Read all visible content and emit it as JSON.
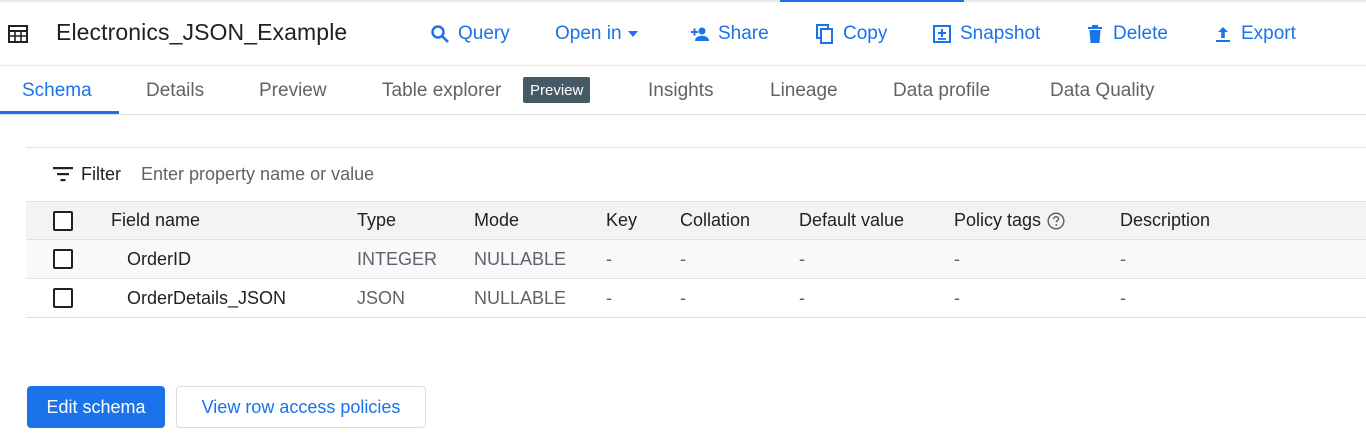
{
  "header": {
    "title": "Electronics_JSON_Example",
    "icon": "table-icon"
  },
  "actions": [
    {
      "label": "Query",
      "icon": "search-icon"
    },
    {
      "label": "Open in",
      "icon": "caret-down-icon"
    },
    {
      "label": "Share",
      "icon": "person-add-icon"
    },
    {
      "label": "Copy",
      "icon": "copy-icon"
    },
    {
      "label": "Snapshot",
      "icon": "snapshot-icon"
    },
    {
      "label": "Delete",
      "icon": "trash-icon"
    },
    {
      "label": "Export",
      "icon": "upload-icon"
    }
  ],
  "tabs": [
    {
      "label": "Schema",
      "active": true
    },
    {
      "label": "Details"
    },
    {
      "label": "Preview"
    },
    {
      "label": "Table explorer",
      "badge": "Preview"
    },
    {
      "label": "Insights"
    },
    {
      "label": "Lineage"
    },
    {
      "label": "Data profile"
    },
    {
      "label": "Data Quality"
    }
  ],
  "filter": {
    "label": "Filter",
    "placeholder": "Enter property name or value",
    "value": ""
  },
  "table": {
    "columns": [
      "Field name",
      "Type",
      "Mode",
      "Key",
      "Collation",
      "Default value",
      "Policy tags",
      "Description"
    ],
    "rows": [
      {
        "name": "OrderID",
        "type": "INTEGER",
        "mode": "NULLABLE",
        "key": "-",
        "collation": "-",
        "default": "-",
        "policy": "-",
        "description": "-"
      },
      {
        "name": "OrderDetails_JSON",
        "type": "JSON",
        "mode": "NULLABLE",
        "key": "-",
        "collation": "-",
        "default": "-",
        "policy": "-",
        "description": "-"
      }
    ]
  },
  "buttons": {
    "edit_schema": "Edit schema",
    "view_row_access": "View row access policies"
  },
  "colors": {
    "accent": "#1a73e8",
    "badge": "#455a64",
    "header_row": "#f1f3f4"
  }
}
